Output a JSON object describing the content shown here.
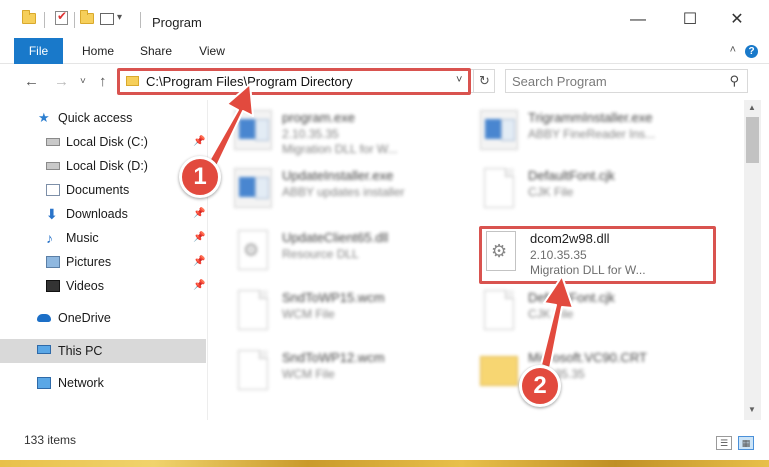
{
  "window": {
    "title": "Program",
    "minimize": "—",
    "maximize": "☐",
    "close": "✕"
  },
  "ribbon": {
    "tabs": [
      "File",
      "Home",
      "Share",
      "View"
    ],
    "help": "?",
    "collapse": "˄"
  },
  "nav": {
    "back": "←",
    "forward": "→",
    "recent": "˅",
    "up": "↑",
    "address": "C:\\Program Files\\Program Directory",
    "dropdown": "˅",
    "refresh": "↻",
    "search_placeholder": "Search Program",
    "search_icon": "⚲"
  },
  "sidebar": {
    "items": [
      {
        "label": "Quick access",
        "icon": "star-icon"
      },
      {
        "label": "Local Disk (C:)",
        "icon": "disk-icon",
        "pinned": true
      },
      {
        "label": "Local Disk (D:)",
        "icon": "disk-icon"
      },
      {
        "label": "Documents",
        "icon": "documents-icon"
      },
      {
        "label": "Downloads",
        "icon": "downloads-icon",
        "pinned": true
      },
      {
        "label": "Music",
        "icon": "music-icon",
        "pinned": true
      },
      {
        "label": "Pictures",
        "icon": "pictures-icon",
        "pinned": true
      },
      {
        "label": "Videos",
        "icon": "videos-icon",
        "pinned": true
      },
      {
        "label": "OneDrive",
        "icon": "onedrive-icon"
      },
      {
        "label": "This PC",
        "icon": "this-pc-icon",
        "selected": true
      },
      {
        "label": "Network",
        "icon": "network-icon"
      }
    ],
    "pin_glyph": "📌"
  },
  "files": [
    {
      "name": "program.exe",
      "line2": "2.10.35.35",
      "line3": "Migration DLL for W...",
      "thumb": "app",
      "blurred": true
    },
    {
      "name": "TrigrammInstaller.exe",
      "line2": "ABBY FineReader Ins...",
      "line3": "",
      "thumb": "app",
      "blurred": true
    },
    {
      "name": "UpdateInstaller.exe",
      "line2": "ABBY updates installer",
      "line3": "",
      "thumb": "app",
      "blurred": true
    },
    {
      "name": "DefaultFont.cjk",
      "line2": "CJK File",
      "line3": "",
      "thumb": "page",
      "blurred": true
    },
    {
      "name": "UpdateClient65.dll",
      "line2": "Resource DLL",
      "line3": "",
      "thumb": "gear",
      "blurred": true
    },
    {
      "name": "dcom2w98.dll",
      "line2": "2.10.35.35",
      "line3": "Migration DLL for W...",
      "thumb": "gear",
      "blurred": false
    },
    {
      "name": "SndToWP15.wcm",
      "line2": "WCM File",
      "line3": "",
      "thumb": "page",
      "blurred": true
    },
    {
      "name": "DefaultFont.cjk",
      "line2": "CJK File",
      "line3": "",
      "thumb": "page",
      "blurred": true
    },
    {
      "name": "SndToWP12.wcm",
      "line2": "WCM File",
      "line3": "",
      "thumb": "page",
      "blurred": true
    },
    {
      "name": "Microsoft.VC90.CRT",
      "line2": "2.10.35.35",
      "line3": "",
      "thumb": "folder",
      "blurred": true
    }
  ],
  "status": {
    "item_count": "133 items"
  },
  "annotations": {
    "step1": "1",
    "step2": "2",
    "color": "#e24a3e"
  }
}
